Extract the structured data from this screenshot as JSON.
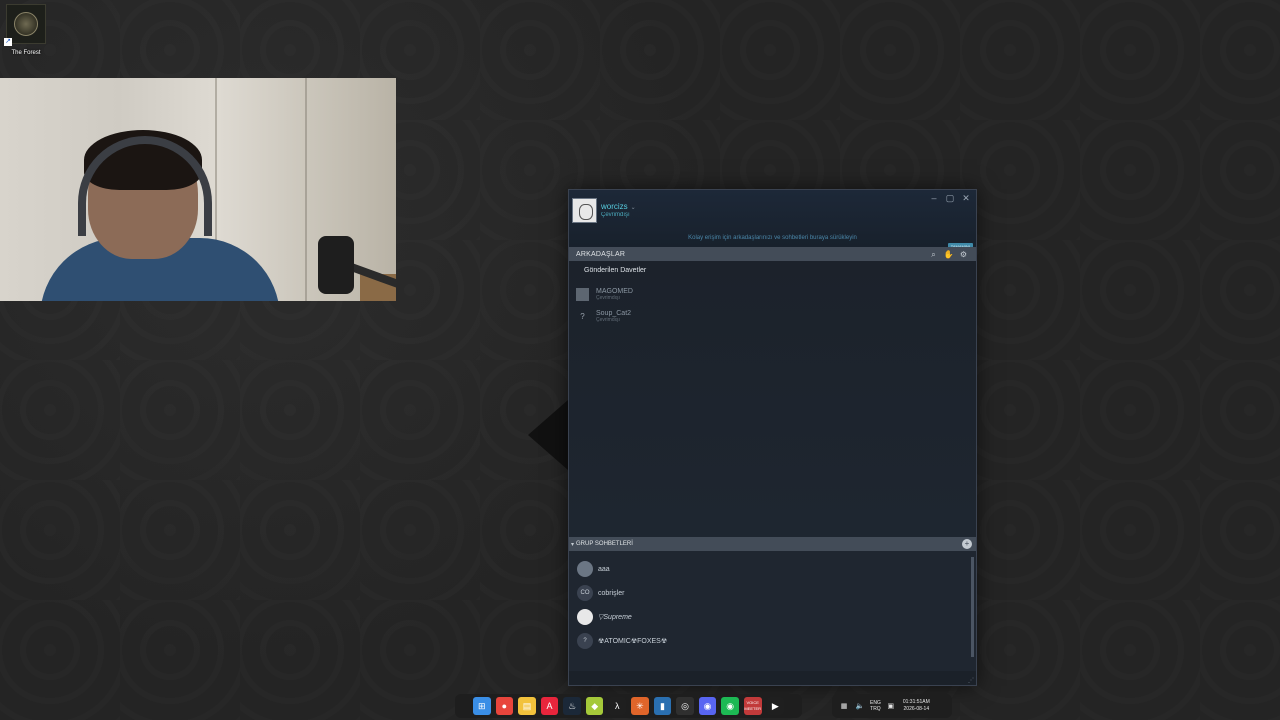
{
  "desktop": {
    "icon_label": "The Forest"
  },
  "steam": {
    "username": "worcizs",
    "status": "Çevrimdışı",
    "favorites_hint": "Kolay erişim için arkadaşlarınızı ve sohbetleri buraya sürükleyin",
    "collapse_label": "TAMAMINI",
    "friends_title": "ARKADAŞLAR",
    "sent_invites_title": "Gönderilen Davetler",
    "friends": [
      {
        "name": "MAGOMED",
        "status": "Çevrimdışı"
      },
      {
        "name": "Soup_Cat2",
        "status": "Çevrimdışı"
      }
    ],
    "groups_title": "GRUP SOHBETLERİ",
    "groups": [
      {
        "name": "aaa",
        "avatar": ""
      },
      {
        "name": "cobrişler",
        "avatar": "CO"
      },
      {
        "name": "▽Supreme",
        "avatar": ""
      },
      {
        "name": "☢ATOMIC☢FOXES☢",
        "avatar": "?"
      }
    ],
    "controls": {
      "minimize": "–",
      "maximize": "▢",
      "close": "✕"
    },
    "accent": "#57cbde"
  },
  "taskbar": {
    "apps": [
      {
        "icon": "windows-start-icon",
        "glyph": "⊞",
        "color": "#3a8ee6"
      },
      {
        "icon": "chrome-icon",
        "glyph": "●",
        "color": "#e8453c"
      },
      {
        "icon": "file-explorer-icon",
        "glyph": "▤",
        "color": "#f2c23c"
      },
      {
        "icon": "adobe-icon",
        "glyph": "A",
        "color": "#e8253c"
      },
      {
        "icon": "steam-icon",
        "glyph": "♨",
        "color": "#1b2838"
      },
      {
        "icon": "app-green-icon",
        "glyph": "◆",
        "color": "#a5c93a"
      },
      {
        "icon": "app-lambda-icon",
        "glyph": "λ",
        "color": "#1f1f1f"
      },
      {
        "icon": "app-asterisk-icon",
        "glyph": "✳",
        "color": "#e0652a"
      },
      {
        "icon": "app-book-icon",
        "glyph": "▮",
        "color": "#2a6fb0"
      },
      {
        "icon": "obs-icon",
        "glyph": "◎",
        "color": "#2f2f2f"
      },
      {
        "icon": "discord-icon",
        "glyph": "◉",
        "color": "#5865f2"
      },
      {
        "icon": "spotify-icon",
        "glyph": "◉",
        "color": "#1db954"
      },
      {
        "icon": "voicemeeter-icon",
        "glyph": "VOICE MEETER",
        "color": "#c23a3a"
      },
      {
        "icon": "media-player-icon",
        "glyph": "▶",
        "color": "#1f1f1f"
      }
    ],
    "tray": {
      "lang_top": "ENG",
      "lang_bottom": "TRQ",
      "time": "01:31:51AM",
      "date": "2026-08-14"
    }
  }
}
